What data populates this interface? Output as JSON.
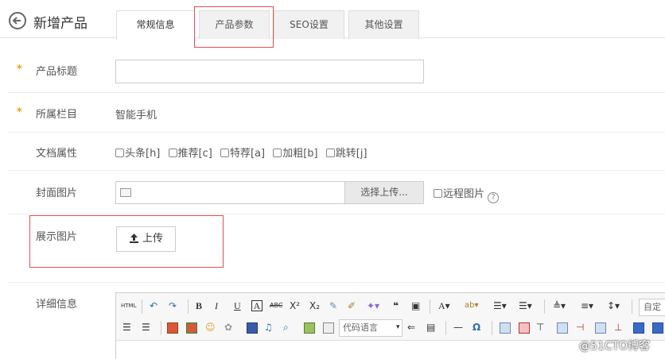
{
  "header": {
    "title": "新增产品",
    "back_icon": "arrow-left-circle-icon"
  },
  "tabs": [
    {
      "label": "常规信息",
      "active": true
    },
    {
      "label": "产品参数",
      "active": false,
      "highlighted": true
    },
    {
      "label": "SEO设置",
      "active": false
    },
    {
      "label": "其他设置",
      "active": false
    }
  ],
  "form": {
    "required_mark": "*",
    "product_title": {
      "label": "产品标题",
      "value": ""
    },
    "column": {
      "label": "所属栏目",
      "value": "智能手机"
    },
    "doc_attrs": {
      "label": "文档属性",
      "options": [
        "头条[h]",
        "推荐[c]",
        "特荐[a]",
        "加粗[b]",
        "跳转[j]"
      ]
    },
    "cover": {
      "label": "封面图片",
      "select_button": "选择上传...",
      "remote_label": "远程图片",
      "help": "?"
    },
    "display": {
      "label": "展示图片",
      "upload_button": "上传"
    },
    "detail": {
      "label": "详细信息"
    }
  },
  "editor": {
    "html_label": "HTML",
    "code_language_placeholder": "代码语言",
    "font_select": "自定",
    "toolbar_row1": [
      "undo-icon",
      "redo-icon",
      "bold",
      "italic",
      "underline",
      "fontborder",
      "strikethrough",
      "superscript",
      "subscript",
      "removeformat",
      "formatmatch",
      "autotypeset",
      "blockquote",
      "pasteplain",
      "forecolor",
      "backcolor",
      "insertorderedlist",
      "insertunorderedlist",
      "rowspacingtop",
      "rowspacingbottom",
      "lineheight"
    ],
    "toolbar_row2": [
      "justify",
      "center",
      "image",
      "multiimage",
      "emotion",
      "scrawl",
      "video",
      "music",
      "attachment",
      "map",
      "gmap",
      "code",
      "pagebreak",
      "template",
      "horizontal",
      "spechars",
      "inserttable",
      "deletetable",
      "insertrow",
      "insertcol",
      "mergecells",
      "splitcells"
    ]
  },
  "watermark": "@51CTO博客",
  "colors": {
    "accent": "#f39c12",
    "highlight": "#d9534f"
  }
}
